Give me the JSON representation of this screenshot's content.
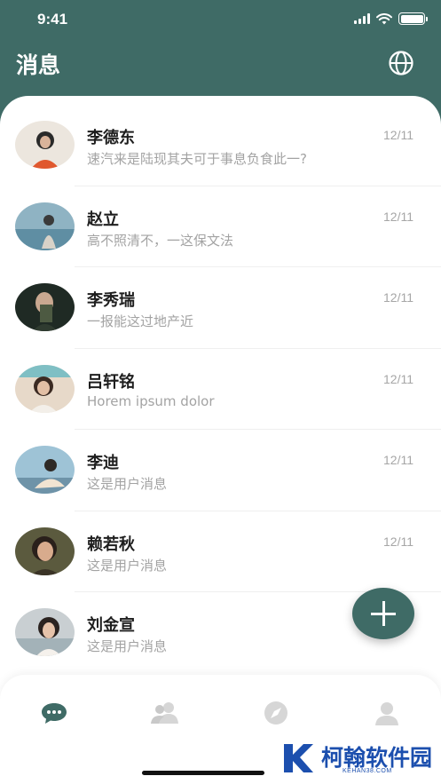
{
  "status_bar": {
    "time": "9:41"
  },
  "header": {
    "title": "消息"
  },
  "messages": [
    {
      "name": "李德东",
      "date": "12/11",
      "preview": "速汽来是陆现其夫可于事息负食此一?"
    },
    {
      "name": "赵立",
      "date": "12/11",
      "preview": "高不照清不，一这保文法"
    },
    {
      "name": "李秀瑞",
      "date": "12/11",
      "preview": "一报能这过地产近"
    },
    {
      "name": "吕轩铭",
      "date": "12/11",
      "preview": "Horem ipsum dolor"
    },
    {
      "name": "李迪",
      "date": "12/11",
      "preview": "这是用户消息"
    },
    {
      "name": "赖若秋",
      "date": "12/11",
      "preview": "这是用户消息"
    },
    {
      "name": "刘金宣",
      "date": "",
      "preview": "这是用户消息"
    }
  ],
  "tabs": [
    {
      "icon": "chat-bubble-icon",
      "active": true
    },
    {
      "icon": "contacts-icon",
      "active": false
    },
    {
      "icon": "compass-icon",
      "active": false
    },
    {
      "icon": "profile-icon",
      "active": false
    }
  ],
  "watermark": {
    "title": "柯翰软件园",
    "subtitle": "KEHAN38.COM"
  },
  "colors": {
    "primary": "#3f6b66",
    "inactive_icon": "#d6d6d6",
    "watermark": "#1c4fae"
  }
}
